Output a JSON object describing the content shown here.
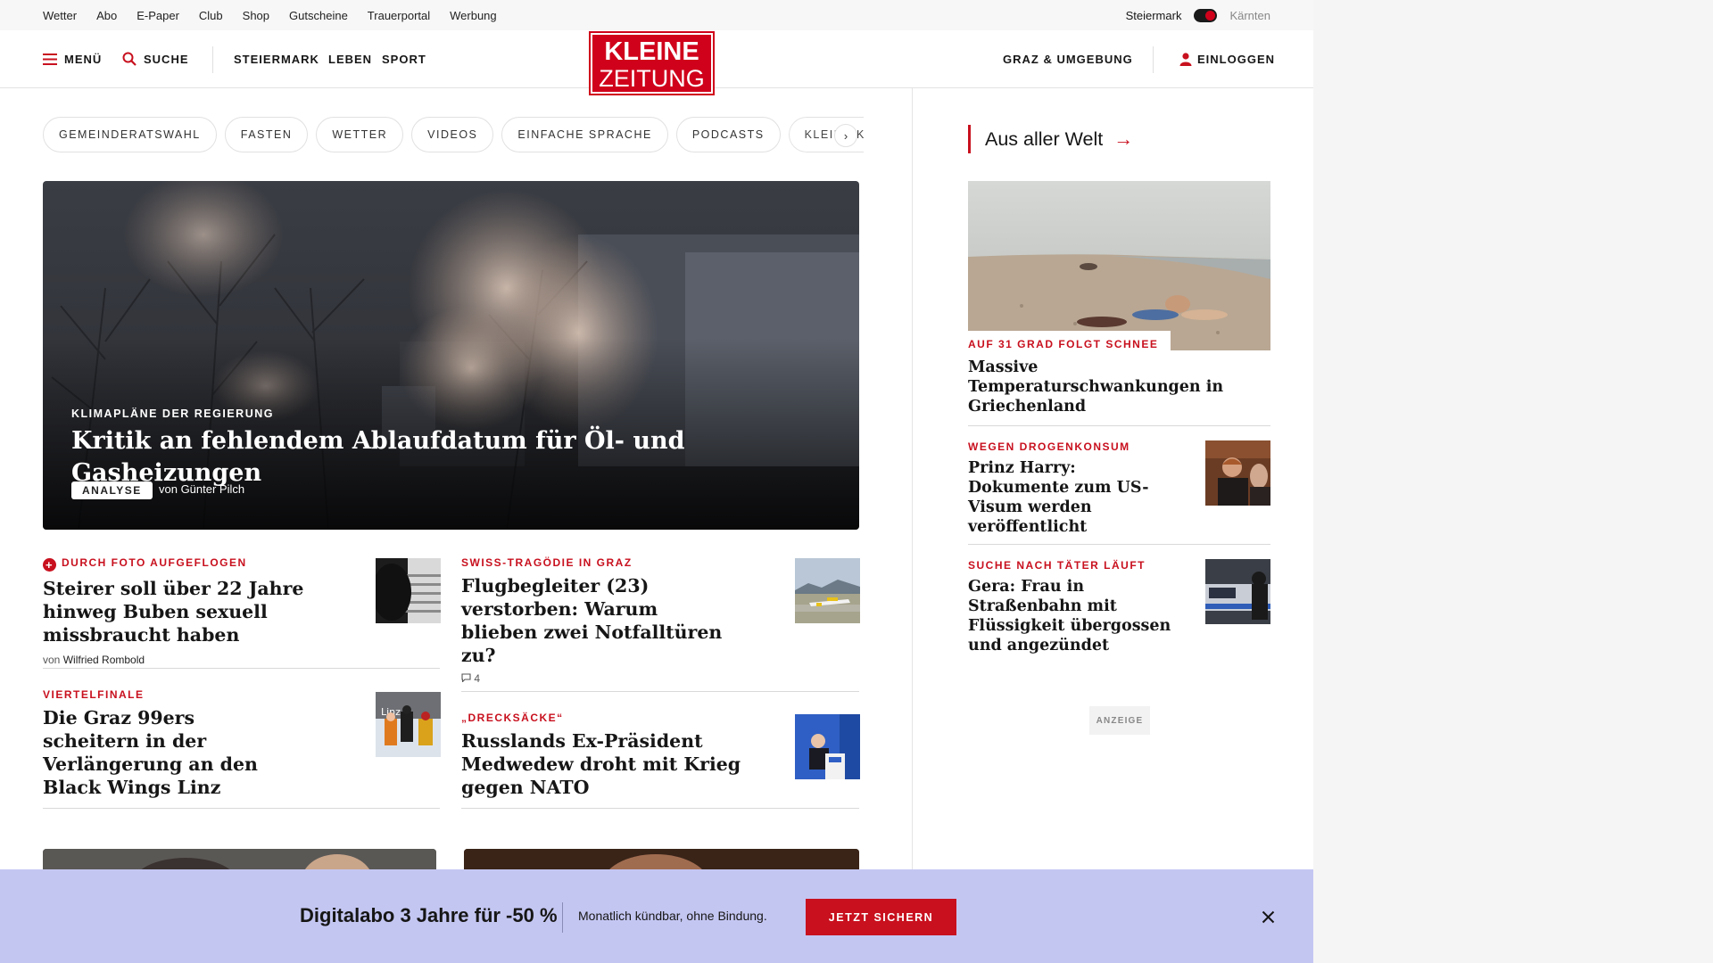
{
  "utility_bar": {
    "links": [
      "Wetter",
      "Abo",
      "E-Paper",
      "Club",
      "Shop",
      "Gutscheine",
      "Trauerportal",
      "Werbung"
    ],
    "region_active": "Steiermark",
    "region_inactive": "Kärnten"
  },
  "header": {
    "menu_label": "MENÜ",
    "search_label": "SUCHE",
    "nav": [
      "STEIERMARK",
      "LEBEN",
      "SPORT"
    ],
    "logo_line1": "KLEINE",
    "logo_line2": "ZEITUNG",
    "region_link": "GRAZ & UMGEBUNG",
    "login_label": "EINLOGGEN"
  },
  "chips": [
    "GEMEINDERATSWAHL",
    "FASTEN",
    "WETTER",
    "VIDEOS",
    "EINFACHE SPRACHE",
    "PODCASTS",
    "KLEINE KINDE"
  ],
  "chips_next_icon": "chevron-right-icon",
  "hero": {
    "kicker": "KLIMAPLÄNE DER REGIERUNG",
    "title": "Kritik an fehlendem Ablaufdatum für Öl- und Gasheizungen",
    "badge": "ANALYSE",
    "author": "von Günter Pilch"
  },
  "teasers": [
    {
      "kicker": "DURCH FOTO AUFGEFLOGEN",
      "title": "Steirer soll über 22 Jahre hinweg Buben sexuell missbraucht haben",
      "meta_prefix": "von",
      "meta_author": "Wilfried Rombold",
      "premium": true
    },
    {
      "kicker": "SWISS-TRAGÖDIE IN GRAZ",
      "title": "Flugbegleiter (23) verstorben: Warum blieben zwei Notfalltüren zu?",
      "comments": "4"
    },
    {
      "kicker": "VIERTELFINALE",
      "title": "Die Graz 99ers scheitern in der Verlängerung an den Black Wings Linz"
    },
    {
      "kicker": "„DRECKSÄCKE“",
      "title": "Russlands Ex-Präsident Medwedew droht mit Krieg gegen NATO"
    }
  ],
  "sidebar": {
    "section_title": "Aus aller Welt",
    "items": [
      {
        "kicker": "AUF 31 GRAD FOLGT SCHNEE",
        "title": "Massive Temperaturschwankungen in Griechenland"
      },
      {
        "kicker": "WEGEN DROGENKONSUM",
        "title": "Prinz Harry: Dokumente zum US-Visum werden veröffentlicht"
      },
      {
        "kicker": "SUCHE NACH TÄTER LÄUFT",
        "title": "Gera: Frau in Straßenbahn mit Flüssigkeit übergossen und angezündet"
      }
    ],
    "ad_label": "ANZEIGE"
  },
  "promo": {
    "title": "Digitalabo 3 Jahre für -50 %",
    "subtitle": "Monatlich kündbar, ohne Bindung.",
    "button": "JETZT SICHERN"
  },
  "colors": {
    "brand_red": "#d0021b",
    "kicker_red": "#c8101e",
    "promo_bg": "#c4c6f2"
  }
}
